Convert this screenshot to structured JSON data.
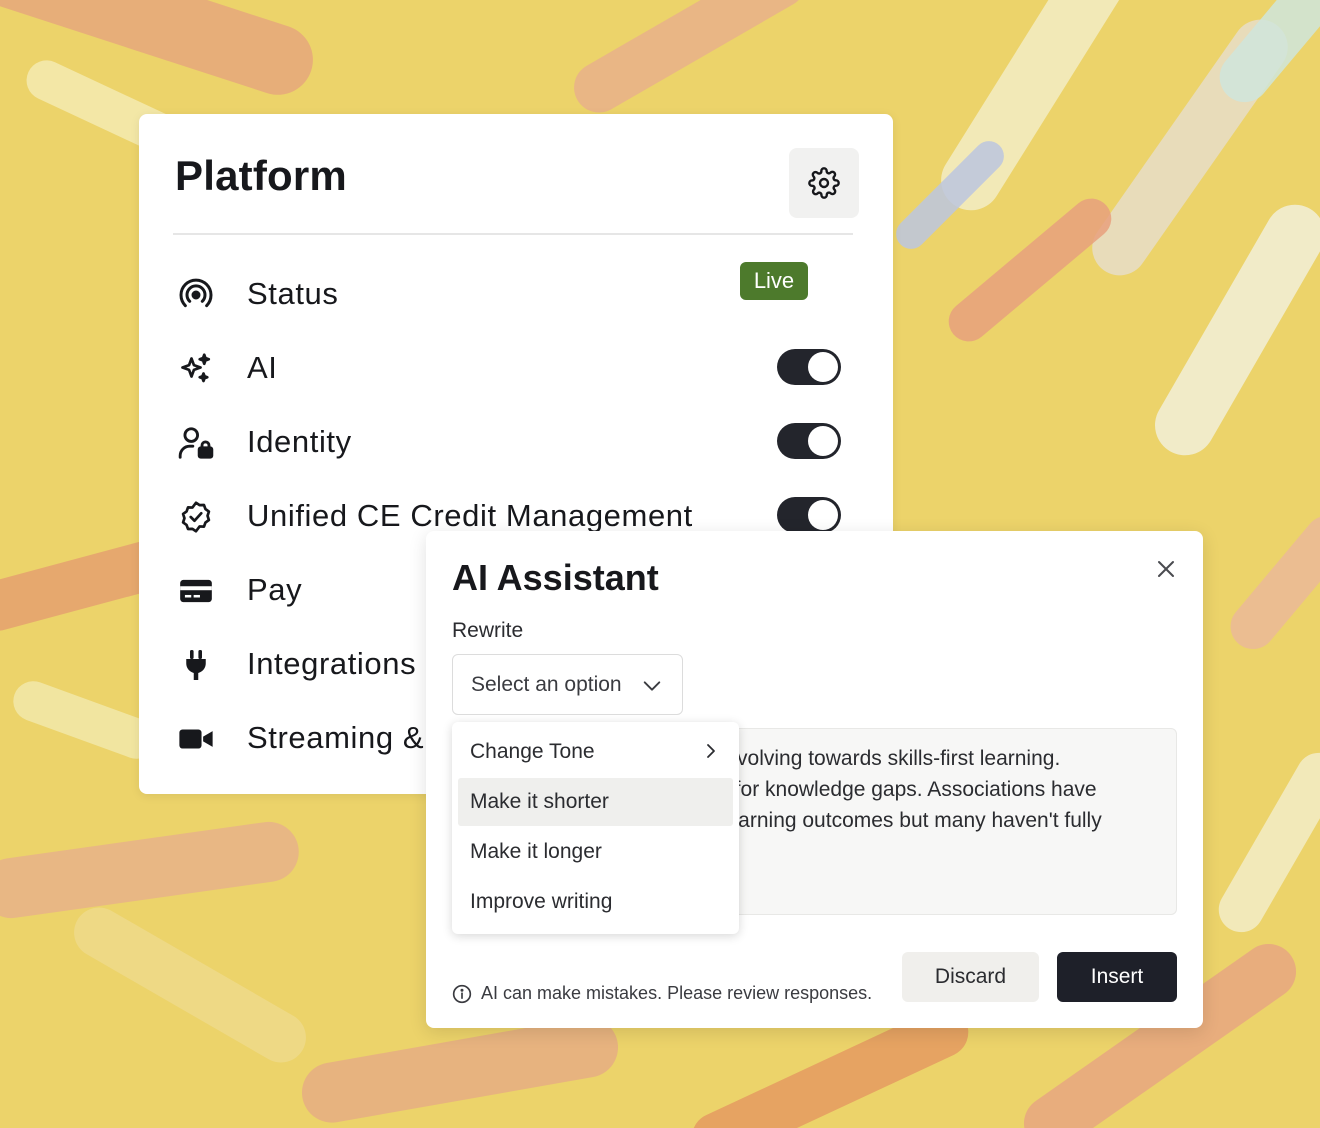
{
  "platform": {
    "title": "Platform",
    "rows": [
      {
        "label": "Status",
        "icon": "broadcast-icon",
        "badge": "Live"
      },
      {
        "label": "AI",
        "icon": "sparkles-icon",
        "toggle": true
      },
      {
        "label": "Identity",
        "icon": "user-lock-icon",
        "toggle": true
      },
      {
        "label": "Unified CE Credit Management",
        "icon": "badge-check-icon",
        "toggle": true
      },
      {
        "label": "Pay",
        "icon": "credit-card-icon"
      },
      {
        "label": "Integrations",
        "icon": "plug-icon"
      },
      {
        "label": "Streaming &",
        "icon": "video-camera-icon"
      }
    ]
  },
  "dialog": {
    "title": "AI Assistant",
    "rewrite_label": "Rewrite",
    "select_placeholder": "Select an option",
    "options": [
      {
        "label": "Change Tone",
        "has_submenu": true
      },
      {
        "label": "Make it shorter",
        "highlighted": true
      },
      {
        "label": "Make it longer"
      },
      {
        "label": "Improve writing"
      }
    ],
    "text_lines": [
      "s evolving towards skills-first learning.",
      "AI for knowledge gaps. Associations have",
      "r learning outcomes but many haven't fully"
    ],
    "disclaimer": "AI can make mistakes. Please review responses.",
    "discard_label": "Discard",
    "insert_label": "Insert"
  },
  "colors": {
    "live_badge": "#4d7a2c",
    "toggle_on": "#23252c",
    "insert_button": "#1e2029",
    "background": "#ecd36a"
  }
}
